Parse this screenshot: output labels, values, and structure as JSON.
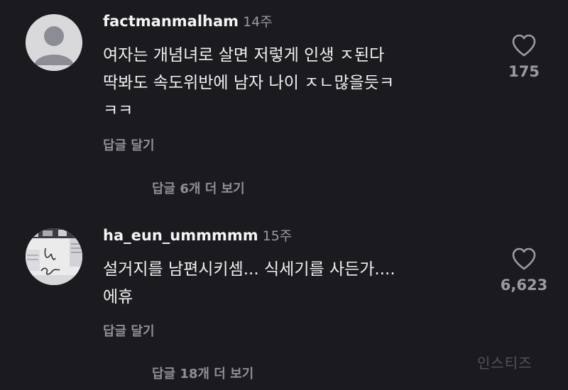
{
  "comments": [
    {
      "username": "factmanmalham",
      "time": "14주",
      "line1": "여자는 개념녀로 살면 저렇게 인생 ㅈ된다",
      "line2": "딱봐도 속도위반에 남자 나이 ㅈㄴ많을듯ㅋ",
      "line3": "ㅋㅋ",
      "likes": "175",
      "reply_label": "답글 달기",
      "view_replies": "답글 6개 더 보기",
      "avatar_icon": "default-user-icon"
    },
    {
      "username": "ha_eun_ummmmm",
      "time": "15주",
      "line1": "설거지를 남편시키셈... 식세기를 사든가....",
      "line2": "에휴",
      "likes": "6,623",
      "reply_label": "답글 달기",
      "view_replies": "답글 18개 더 보기",
      "avatar_icon": "profile-photo"
    }
  ],
  "watermark": "인스티즈"
}
